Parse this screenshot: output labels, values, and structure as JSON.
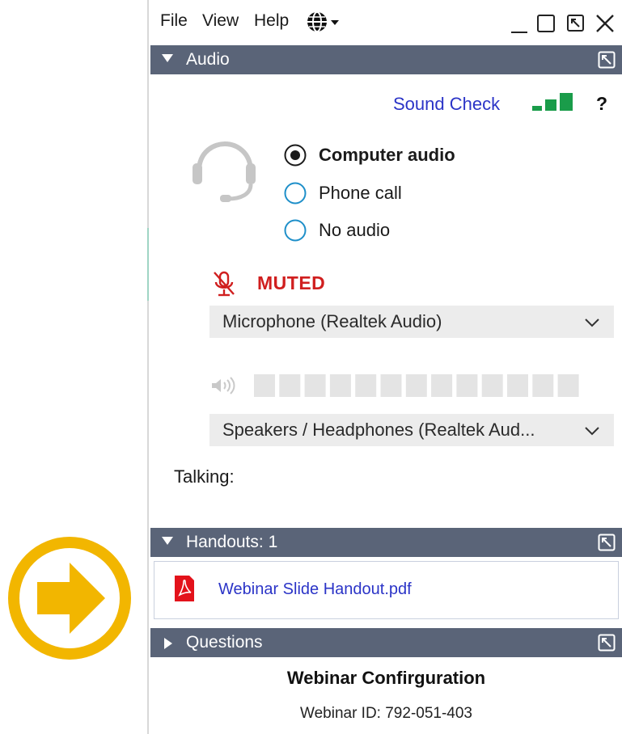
{
  "menu": {
    "file": "File",
    "view": "View",
    "help": "Help",
    "language_icon": "globe-icon"
  },
  "window_controls": [
    "minimize-icon",
    "maximize-icon",
    "restore-icon",
    "close-icon"
  ],
  "audio": {
    "header": "Audio",
    "sound_check": "Sound Check",
    "help": "?",
    "options": {
      "computer": "Computer audio",
      "phone": "Phone call",
      "none": "No audio"
    },
    "selected_option": "Computer audio",
    "status": "MUTED",
    "microphone": "Microphone (Realtek Audio)",
    "speakers": "Speakers / Headphones (Realtek Aud...",
    "talking_label": "Talking:",
    "speaker_level": 0
  },
  "handouts": {
    "header": "Handouts: 1",
    "file": "Webinar Slide Handout.pdf"
  },
  "questions": {
    "header": "Questions"
  },
  "footer": {
    "title": "Webinar Confirguration",
    "webinar_id": "Webinar ID: 792-051-403"
  },
  "colors": {
    "header_bg": "#5a6478",
    "link": "#2b34c7",
    "muted": "#d01f1f",
    "signal": "#1a9c4a",
    "callout": "#f2b600"
  }
}
